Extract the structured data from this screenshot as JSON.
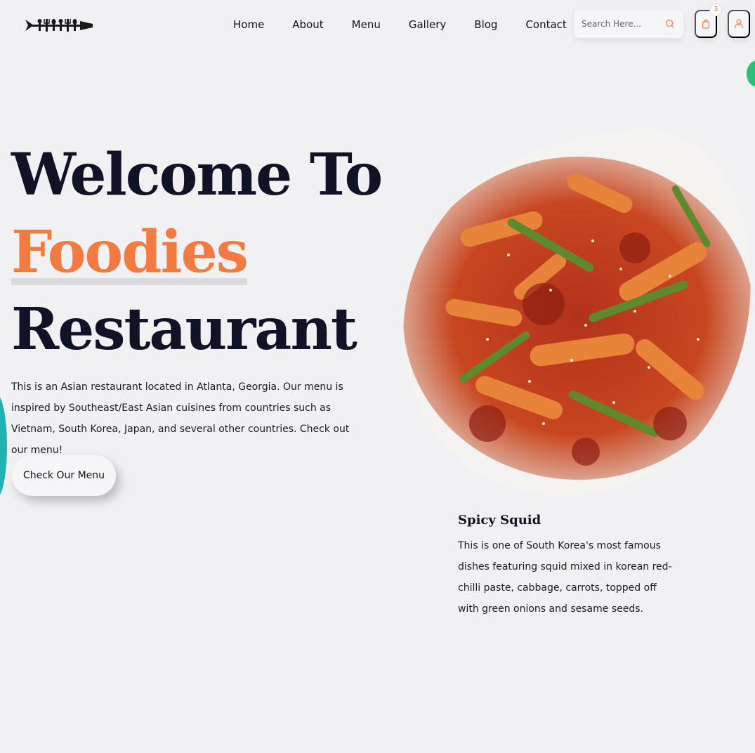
{
  "nav": {
    "items": [
      "Home",
      "About",
      "Menu",
      "Gallery",
      "Blog",
      "Contact"
    ]
  },
  "search": {
    "placeholder": "Search Here..."
  },
  "cart": {
    "count": "3"
  },
  "hero": {
    "line1": "Welcome To",
    "line2": "Foodies",
    "line3": "Restaurant",
    "description": "This is an Asian restaurant located in Atlanta, Georgia. Our menu is inspired by Southeast/East Asian cuisines from countries such as Vietnam, South Korea, Japan, and several other countries. Check out our menu!",
    "button_label": "Check Our Menu"
  },
  "dish": {
    "title": "Spicy Squid",
    "description": "This is one of South Korea's most famous dishes featuring squid mixed in korean red-chilli paste, cabbage, carrots, topped off with green onions and sesame seeds."
  },
  "colors": {
    "accent": "#f37a40",
    "dark": "#111226",
    "background": "#f1f1f3"
  },
  "icons": {
    "search": "search-icon",
    "cart": "shopping-bag-icon",
    "user": "user-icon",
    "logo": "fish-utensils-logo"
  }
}
